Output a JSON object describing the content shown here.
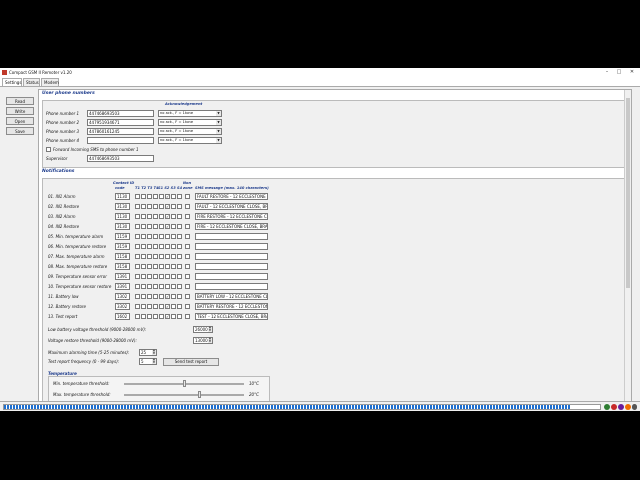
{
  "window": {
    "title": "Compact GSM II Remoter v1.20"
  },
  "tabs": [
    {
      "label": "Settings",
      "active": true
    },
    {
      "label": "Status",
      "active": false
    },
    {
      "label": "Modem",
      "active": false
    }
  ],
  "side_buttons": [
    "Read",
    "Write",
    "Open",
    "Save"
  ],
  "phone_section": {
    "title": "User phone numbers",
    "ack_header": "Acknowledgement",
    "rows": [
      {
        "label": "Phone number 1",
        "value": "447468693503",
        "ack": "no ack., F = 1tone"
      },
      {
        "label": "Phone number 2",
        "value": "447951934671",
        "ack": "no ack., F = 1tone"
      },
      {
        "label": "Phone number 3",
        "value": "447860161245",
        "ack": "no ack., F = 1tone"
      },
      {
        "label": "Phone number 4",
        "value": "",
        "ack": "no ack., F = 1tone"
      }
    ],
    "forward_label": "Forward Incoming SMS to phone number 1",
    "supervisor_label": "Supervisor",
    "supervisor_value": "447468693503"
  },
  "notifications": {
    "title": "Notifications",
    "headers": {
      "contact_id_line1": "Contact ID",
      "contact_id_line2": "code",
      "t_cols": "T1 T2 T3 T4",
      "s_cols": "S1 S2 S3 S4",
      "non_line1": "Non",
      "non_line2": "zone",
      "sms": "SMS message (max. 140 characters)"
    },
    "rows": [
      {
        "label": "01.  IN1 Alarm",
        "code": "1130",
        "checks": "s2",
        "sms": "FAULT RESTORE - 12 ECCLESTONE CLOSE"
      },
      {
        "label": "02.  IN1 Restore",
        "code": "3130",
        "checks": "s2",
        "sms": "FAULT - 12 ECCLESTONE CLOSE, BRADW"
      },
      {
        "label": "03.  IN2 Alarm",
        "code": "1130",
        "checks": "s2",
        "sms": "FIRE RESTORE - 12 ECCLESTONE CLOSE"
      },
      {
        "label": "04.  IN2 Restore",
        "code": "3130",
        "checks": "s2",
        "sms": "FIRE - 12 ECCLESTONE CLOSE, BRADW"
      },
      {
        "label": "05.  Min. temperature alarm",
        "code": "1159",
        "checks": "",
        "sms": ""
      },
      {
        "label": "06.  Min. temperature restore",
        "code": "3159",
        "checks": "",
        "sms": ""
      },
      {
        "label": "07.  Max. temperature alarm",
        "code": "1158",
        "checks": "",
        "sms": ""
      },
      {
        "label": "08.  Max. temperature restore",
        "code": "3158",
        "checks": "",
        "sms": ""
      },
      {
        "label": "09.  Temperature sensor error",
        "code": "1391",
        "checks": "",
        "sms": ""
      },
      {
        "label": "10.  Temperature sensor restore",
        "code": "3391",
        "checks": "",
        "sms": ""
      },
      {
        "label": "11.  Battery low",
        "code": "1302",
        "checks": "s2",
        "sms": "BATTERY LOW - 12 ECCLESTONE CLOSE"
      },
      {
        "label": "12.  Battery restore",
        "code": "3302",
        "checks": "s2",
        "sms": "BATTERY RESTORE - 12 ECCLESTONE C"
      },
      {
        "label": "13.  Test report",
        "code": "1602",
        "checks": "s2",
        "sms": "TEST - 12 ECCLESTONE CLOSE, BRADW"
      }
    ]
  },
  "thresholds": {
    "low_battery_label": "Low battery voltage threshold (9000-28000 mV):",
    "low_battery_value": "26000",
    "voltage_restore_label": "Voltage restore threshold (9000-28000 mV):",
    "voltage_restore_value": "13000",
    "alarming_time_label": "Maximum alarming time (5-25 minutes):",
    "alarming_time_value": "25",
    "test_report_label": "Test report frequency (0 - 99 days):",
    "test_report_value": "5",
    "send_test_label": "Send test report"
  },
  "temperature": {
    "title": "Temperature",
    "min_label": "Min. temperature threshold:",
    "min_value": "10°C",
    "min_level_c": 10,
    "max_label": "Max. temperature threshold:",
    "max_value": "20°C",
    "max_level_c": 20
  },
  "taskbar": {
    "progress_fraction": 0.95
  },
  "colors": {
    "accent": "#1e3c8c",
    "progress": "#1e6fd0",
    "app_icon": "#c0392b"
  }
}
